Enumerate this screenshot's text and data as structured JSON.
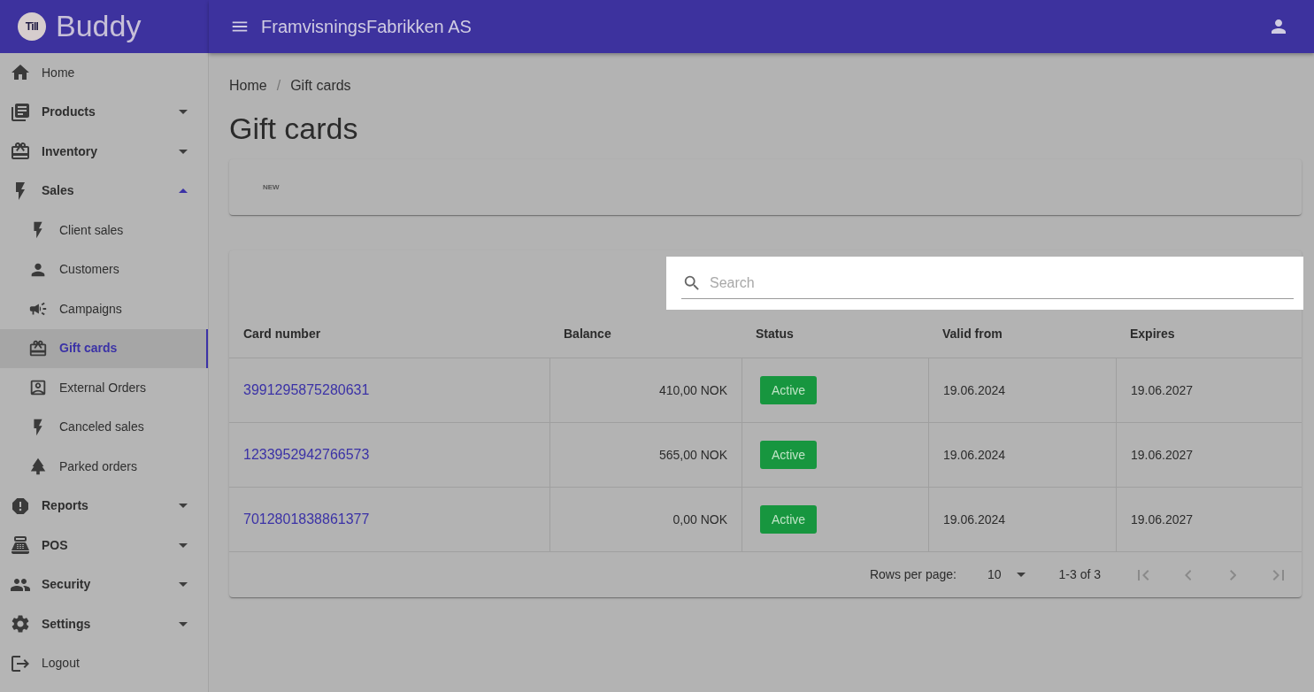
{
  "app": {
    "logo": "Till",
    "name": "Buddy"
  },
  "top_bar": {
    "company": "FramvisningsFabrikken AS"
  },
  "sidebar": {
    "items": [
      {
        "label": "Home",
        "kind": "link",
        "selected": false
      },
      {
        "label": "Products",
        "kind": "group",
        "expanded": false,
        "selected": false
      },
      {
        "label": "Inventory",
        "kind": "group",
        "expanded": false,
        "selected": false
      },
      {
        "label": "Sales",
        "kind": "group",
        "expanded": true,
        "selected": false,
        "children": [
          {
            "label": "Client sales",
            "selected": false
          },
          {
            "label": "Customers",
            "selected": false
          },
          {
            "label": "Campaigns",
            "selected": false
          },
          {
            "label": "Gift cards",
            "selected": true
          },
          {
            "label": "External Orders",
            "selected": false
          },
          {
            "label": "Canceled sales",
            "selected": false
          },
          {
            "label": "Parked orders",
            "selected": false
          }
        ]
      },
      {
        "label": "Reports",
        "kind": "group",
        "expanded": false,
        "selected": false
      },
      {
        "label": "POS",
        "kind": "group",
        "expanded": false,
        "selected": false
      },
      {
        "label": "Security",
        "kind": "group",
        "expanded": false,
        "selected": false
      },
      {
        "label": "Settings",
        "kind": "group",
        "expanded": false,
        "selected": false
      },
      {
        "label": "Logout",
        "kind": "link",
        "selected": false
      }
    ]
  },
  "breadcrumb": {
    "items": [
      "Home",
      "Gift cards"
    ],
    "separator": "/"
  },
  "page_title": "Gift cards",
  "toolbar": {
    "buttons": [
      "NEW"
    ]
  },
  "table": {
    "search": {
      "placeholder": "Search"
    },
    "columns": [
      "Card number",
      "Balance",
      "Status",
      "Valid from",
      "Expires"
    ],
    "rows": [
      {
        "card_number": "3991295875280631",
        "balance": "410,00 NOK",
        "status": "Active",
        "valid_from": "19.06.2024",
        "expires": "19.06.2027"
      },
      {
        "card_number": "1233952942766573",
        "balance": "565,00 NOK",
        "status": "Active",
        "valid_from": "19.06.2024",
        "expires": "19.06.2027"
      },
      {
        "card_number": "7012801838861377",
        "balance": "0,00 NOK",
        "status": "Active",
        "valid_from": "19.06.2024",
        "expires": "19.06.2027"
      }
    ],
    "pagination": {
      "rows_per_page_label": "Rows per page:",
      "rows_per_page": "10",
      "range": "1-3 of 3",
      "nav_buttons": [
        {
          "kind": "first",
          "disabled": true
        },
        {
          "kind": "previous",
          "disabled": true
        },
        {
          "kind": "next",
          "disabled": true
        },
        {
          "kind": "last",
          "disabled": true
        }
      ]
    }
  }
}
